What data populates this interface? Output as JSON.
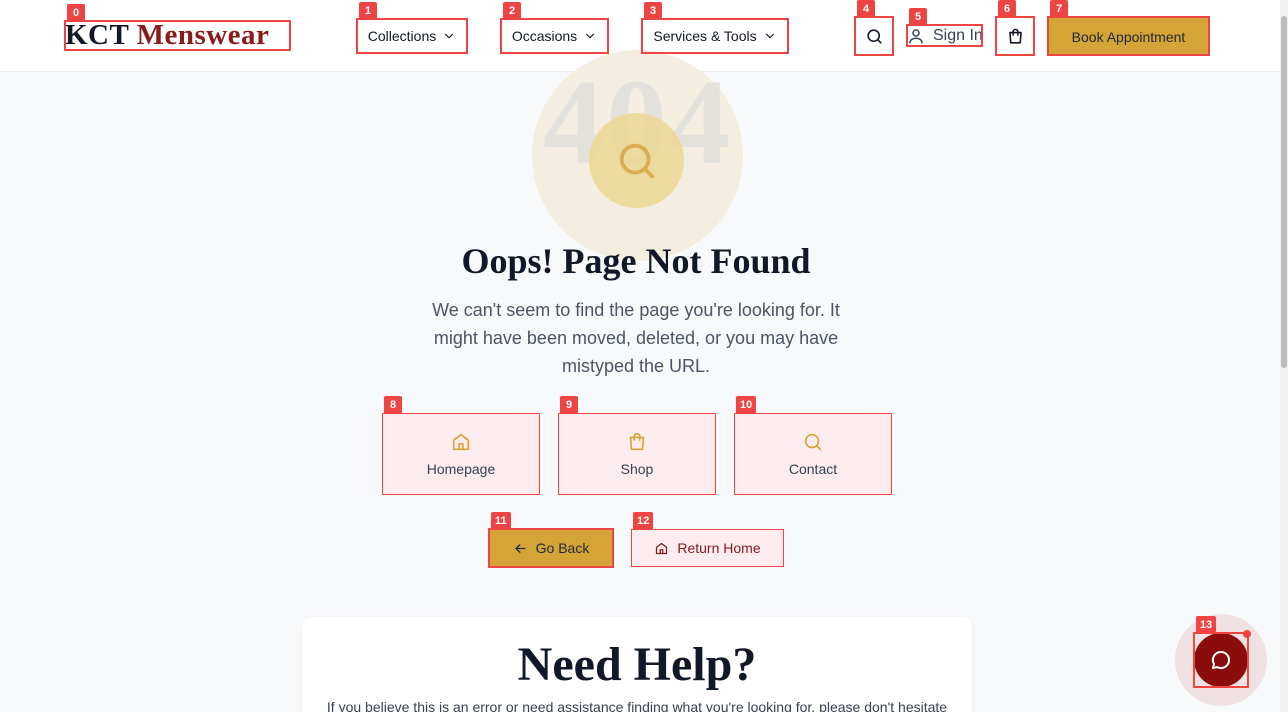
{
  "header": {
    "logo_part1": "KCT",
    "logo_part2": "Menswear",
    "nav": [
      {
        "label": "Collections",
        "icon": "chevron-down-icon"
      },
      {
        "label": "Occasions",
        "icon": "chevron-down-icon"
      },
      {
        "label": "Services & Tools",
        "icon": "chevron-down-icon"
      }
    ],
    "search_icon": "search-icon",
    "sign_in_label": "Sign In",
    "cart_icon": "shopping-bag-icon",
    "book_label": "Book Appointment"
  },
  "hero": {
    "code": "404",
    "title": "Oops! Page Not Found",
    "description": "We can't seem to find the page you're looking for. It might have been moved, deleted, or you may have mistyped the URL."
  },
  "quick_links": [
    {
      "label": "Homepage",
      "icon": "home-icon"
    },
    {
      "label": "Shop",
      "icon": "shopping-bag-icon"
    },
    {
      "label": "Contact",
      "icon": "search-icon"
    }
  ],
  "actions": {
    "go_back": "Go Back",
    "return_home": "Return Home"
  },
  "help": {
    "title": "Need Help?",
    "text": "If you believe this is an error or need assistance finding what you're looking for, please don't hesitate"
  },
  "chat": {
    "icon": "chat-bubble-icon"
  },
  "marks": [
    "0",
    "1",
    "2",
    "3",
    "4",
    "5",
    "6",
    "7",
    "8",
    "9",
    "10",
    "11",
    "12",
    "13"
  ],
  "colors": {
    "accent_gold": "#d4a437",
    "brand_burgundy": "#8b1a1a",
    "mark_red": "#ef4444",
    "chat_red": "#8b0c0c"
  }
}
